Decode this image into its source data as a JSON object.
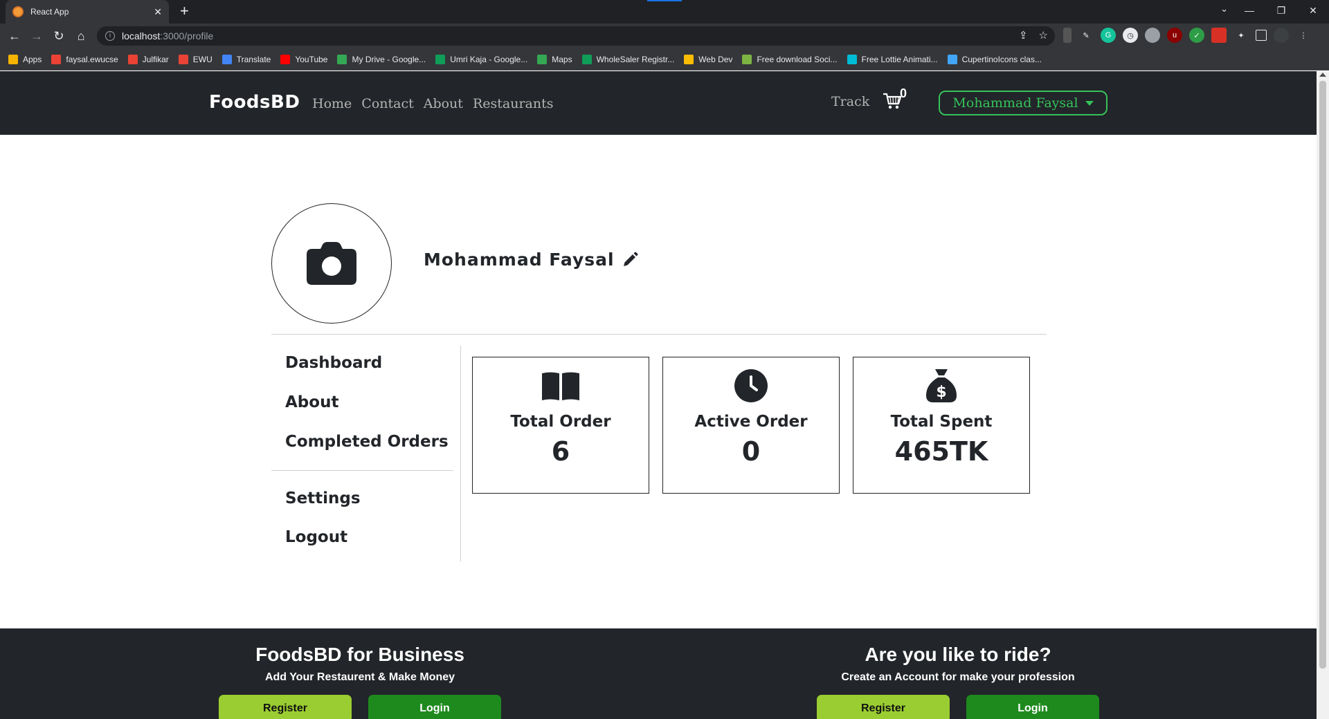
{
  "browser": {
    "tab_title": "React App",
    "tab_close": "✕",
    "new_tab": "+",
    "url_host": "localhost",
    "url_path": ":3000/profile",
    "bookmarks": [
      {
        "label": "Apps",
        "color": "#f4b400"
      },
      {
        "label": "faysal.ewucse",
        "color": "#ea4335"
      },
      {
        "label": "Julfikar",
        "color": "#ea4335"
      },
      {
        "label": "EWU",
        "color": "#ea4335"
      },
      {
        "label": "Translate",
        "color": "#4285f4"
      },
      {
        "label": "YouTube",
        "color": "#ff0000"
      },
      {
        "label": "My Drive - Google...",
        "color": "#34a853"
      },
      {
        "label": "Umri Kaja - Google...",
        "color": "#0f9d58"
      },
      {
        "label": "Maps",
        "color": "#34a853"
      },
      {
        "label": "WholeSaler Registr...",
        "color": "#0f9d58"
      },
      {
        "label": "Web Dev",
        "color": "#fbbc04"
      },
      {
        "label": "Free download Soci...",
        "color": "#7cb342"
      },
      {
        "label": "Free Lottie Animati...",
        "color": "#00bcd4"
      },
      {
        "label": "CupertinoIcons clas...",
        "color": "#42a5f5"
      }
    ]
  },
  "navbar": {
    "brand": "FoodsBD",
    "links": [
      "Home",
      "Contact",
      "About",
      "Restaurants"
    ],
    "track": "Track",
    "cart_count": "0",
    "user_name": "Mohammad Faysal"
  },
  "profile": {
    "name": "Mohammad Faysal"
  },
  "sidemenu": {
    "items": [
      "Dashboard",
      "About",
      "Completed Orders",
      "Settings",
      "Logout"
    ]
  },
  "stats": [
    {
      "label": "Total Order",
      "value": "6",
      "icon": "book-icon"
    },
    {
      "label": "Active Order",
      "value": "0",
      "icon": "clock-icon"
    },
    {
      "label": "Total Spent",
      "value": "465TK",
      "icon": "money-bag-icon"
    }
  ],
  "footer": {
    "business": {
      "title": "FoodsBD for Business",
      "subtitle": "Add Your Restaurent & Make Money",
      "register": "Register",
      "login": "Login"
    },
    "rider": {
      "title": "Are you like to ride?",
      "subtitle": "Create an Account for make your profession",
      "register": "Register",
      "login": "Login"
    }
  },
  "colors": {
    "navbar_bg": "#222529",
    "accent_green": "#36c35a",
    "register_btn": "#9acd32",
    "login_btn": "#1e8a1e"
  }
}
